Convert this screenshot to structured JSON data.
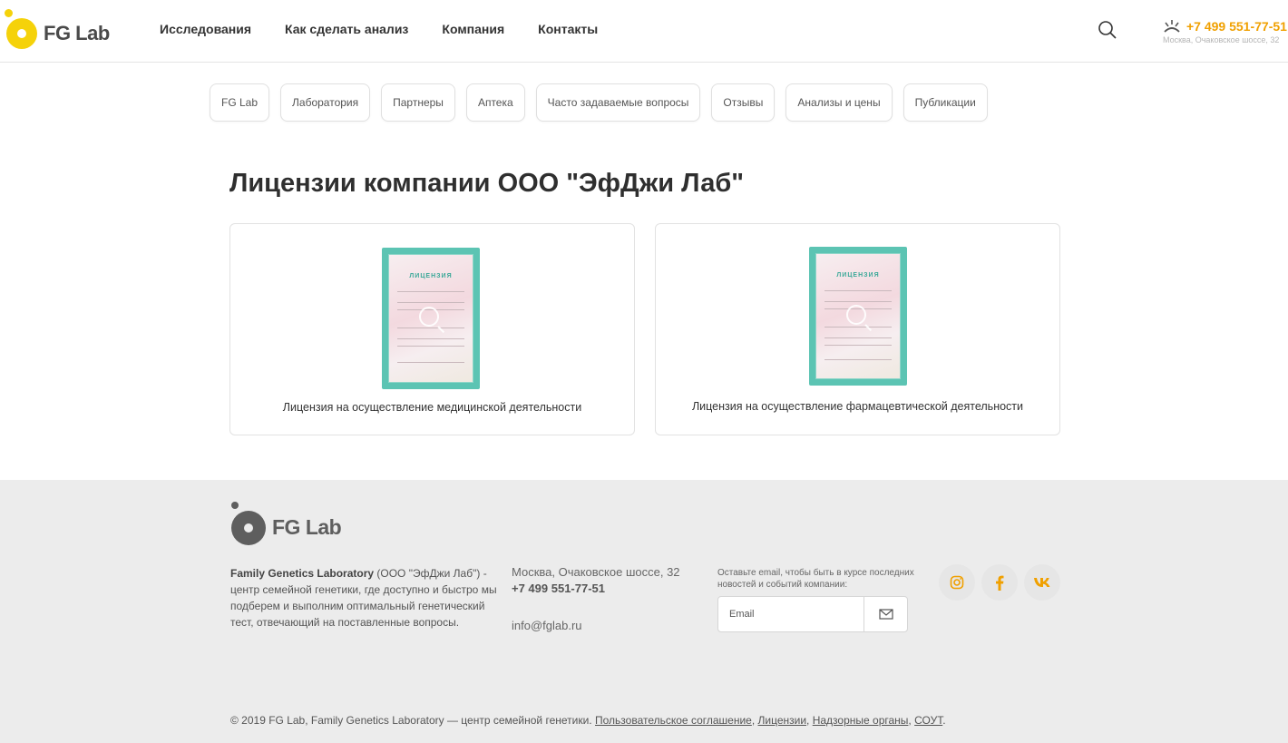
{
  "header": {
    "logo_text": "FG Lab",
    "nav": [
      "Исследования",
      "Как сделать анализ",
      "Компания",
      "Контакты"
    ],
    "phone": "+7 499 551-77-51",
    "address": "Москва, Очаковское шоссе, 32"
  },
  "subnav": [
    "FG Lab",
    "Лаборатория",
    "Партнеры",
    "Аптека",
    "Часто задаваемые вопросы",
    "Отзывы",
    "Анализы и цены",
    "Публикации"
  ],
  "main": {
    "title": "Лицензии компании ООО \"ЭфДжи Лаб\"",
    "cards": [
      {
        "caption": "Лицензия на осуществление медицинской деятельности",
        "doc_title": "ЛИЦЕНЗИЯ"
      },
      {
        "caption": "Лицензия на осуществление фармацевтической деятельности",
        "doc_title": "ЛИЦЕНЗИЯ"
      }
    ]
  },
  "footer": {
    "logo_text": "FG Lab",
    "desc_bold": "Family Genetics Laboratory",
    "desc_rest": " (ООО \"ЭфДжи Лаб\") - центр семейной генетики, где доступно и быстро мы подберем и выполним оптимальный генетический тест, отвечающий на поставленные вопросы.",
    "address": "Москва, Очаковское шоссе, 32",
    "phone": "+7 499 551-77-51",
    "email": "info@fglab.ru",
    "subscribe_text": "Оставьте email, чтобы быть в курсе последних новостей и событий компании:",
    "email_placeholder": "Email",
    "socials": [
      "instagram-icon",
      "facebook-icon",
      "vk-icon"
    ],
    "copyright": "© 2019 FG Lab, Family Genetics Laboratory — центр семейной генетики.",
    "links": [
      "Пользовательское соглашение",
      "Лицензии",
      "Надзорные органы",
      "СОУТ"
    ]
  },
  "colors": {
    "accent": "#f0a000",
    "logo_yellow": "#f5d20a",
    "footer_bg": "#ececec"
  }
}
